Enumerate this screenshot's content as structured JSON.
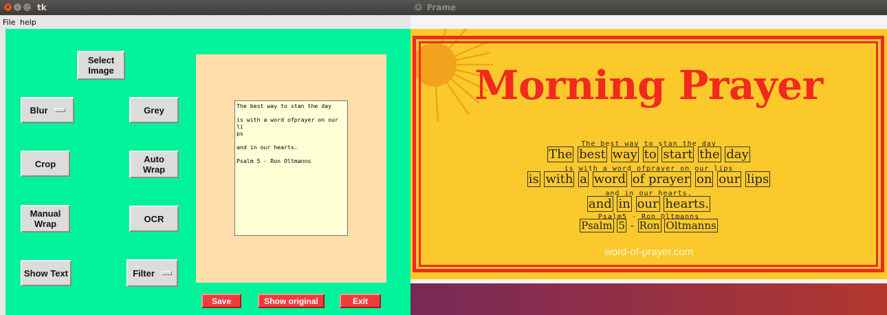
{
  "tk_window": {
    "title": "tk",
    "menu": [
      "File",
      "help"
    ],
    "buttons": {
      "select_image": "Select\nImage",
      "blur": "Blur",
      "grey": "Grey",
      "crop": "Crop",
      "auto_wrap": "Auto\nWrap",
      "manual_wrap": "Manual\nWrap",
      "ocr": "OCR",
      "show_text": "Show Text",
      "filter": "Filter"
    },
    "textbox_lines": [
      "The best way to stan the day",
      "is with a word ofprayer on our li\nps",
      "and in our hearts.",
      "Psalm 5 - Ron Oltmanns"
    ],
    "bottom_buttons": {
      "save": "Save",
      "show_original": "Show original",
      "exit": "Exit"
    },
    "colors": {
      "panel": "#00f39a",
      "canvas": "#fedeab",
      "red_button": "#f33b3b"
    }
  },
  "frame_window": {
    "title": "Frame",
    "poster_title": "Morning Prayer",
    "ocr_labels": [
      "The best way to stan the day",
      "is with a word ofprayer on our lips",
      "and in our hearts.",
      "Psalm5 - Ron Oltmanns"
    ],
    "lines": [
      [
        "The",
        "best",
        "way",
        "to",
        "start",
        "the",
        "day"
      ],
      [
        "is",
        "with",
        "a",
        "word",
        "of prayer",
        "on",
        "our",
        "lips"
      ],
      [
        "and",
        "in",
        "our",
        "hearts."
      ],
      [
        "Psalm",
        "5",
        "-",
        "Ron",
        "Oltmanns"
      ]
    ],
    "footer": "word-of-prayer.com",
    "colors": {
      "poster_bg": "#fbc92c",
      "title_red": "#f02a1f"
    }
  }
}
